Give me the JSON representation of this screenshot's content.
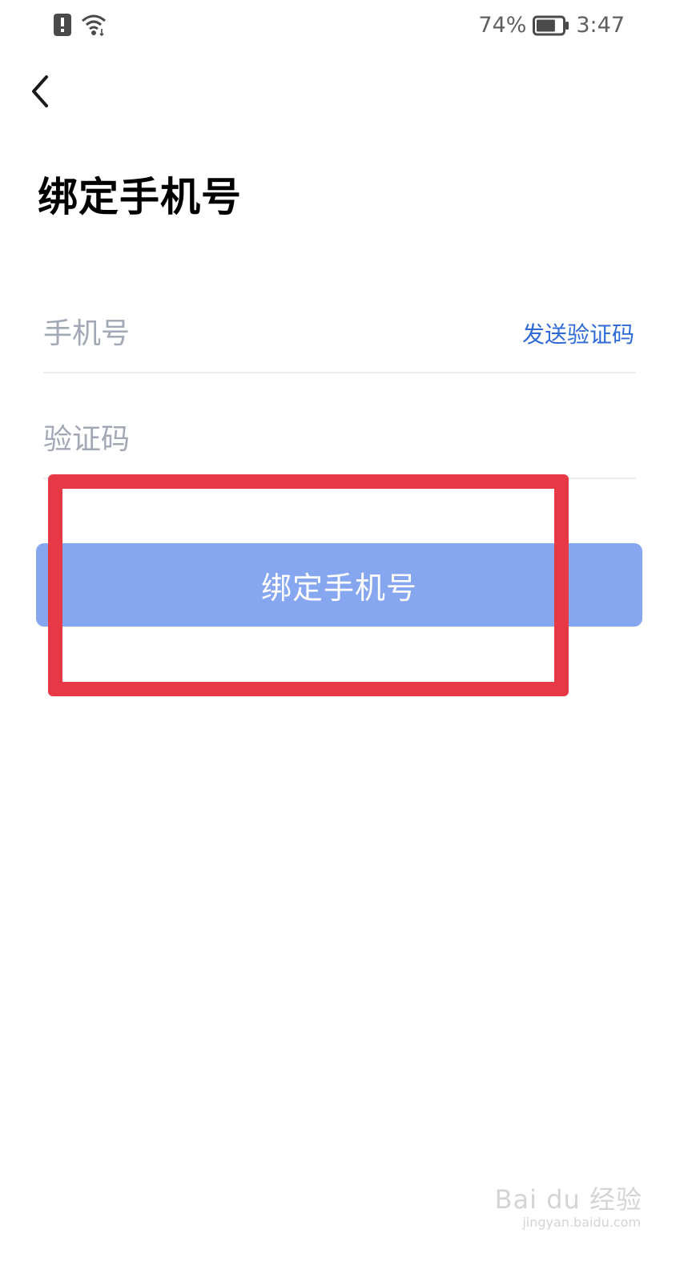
{
  "status_bar": {
    "battery_percent": "74%",
    "time": "3:47",
    "battery_level": 0.74
  },
  "page": {
    "title": "绑定手机号"
  },
  "form": {
    "phone_placeholder": "手机号",
    "send_code_label": "发送验证码",
    "code_placeholder": "验证码",
    "submit_label": "绑定手机号"
  },
  "watermark": {
    "main": "Bai du 经验",
    "sub": "jingyan.baidu.com"
  },
  "colors": {
    "accent": "#2f6ad6",
    "button_bg": "#87a6f0",
    "highlight": "#e63845"
  }
}
